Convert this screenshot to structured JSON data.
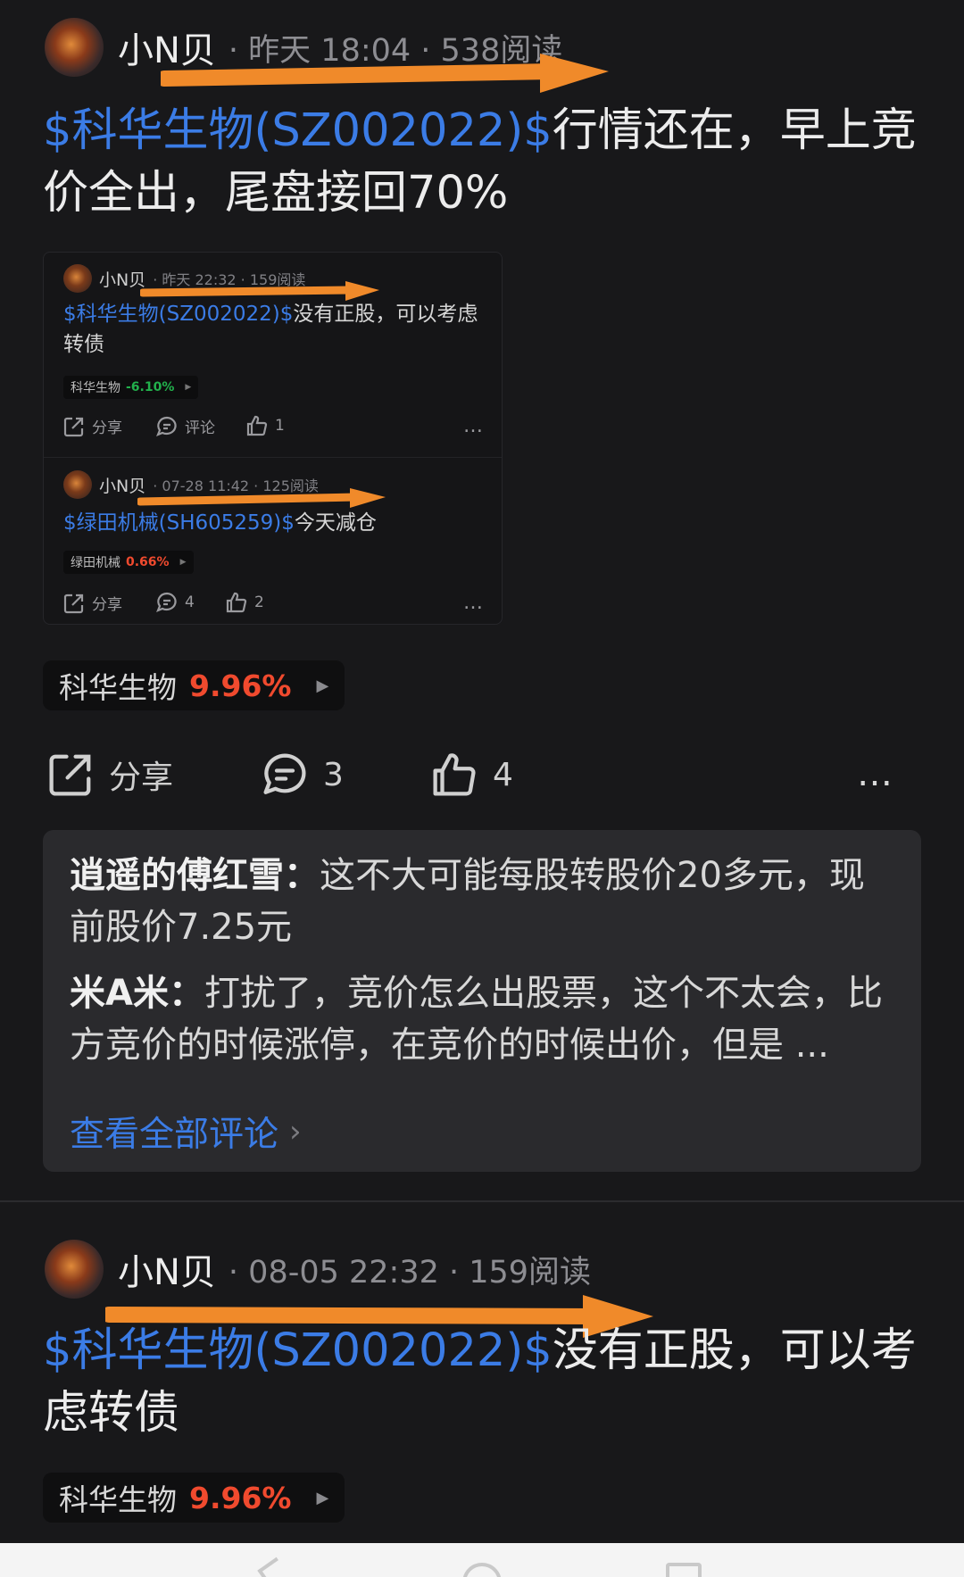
{
  "posts": [
    {
      "username": "小N贝",
      "meta": "· 昨天 18:04 · 538阅读",
      "cashtag": "$科华生物(SZ002022)$",
      "text": "行情还在，早上竞价全出，尾盘接回70%",
      "stock": {
        "name": "科华生物",
        "change": "9.96%"
      },
      "embedded": [
        {
          "username": "小N贝",
          "meta": "· 昨天 22:32 · 159阅读",
          "cashtag": "$科华生物(SZ002022)$",
          "text": "没有正股，可以考虑转债",
          "stock": {
            "name": "科华生物",
            "change": "-6.10%",
            "color": "#22b14c"
          },
          "share": "分享",
          "comment": "评论",
          "likes": "1"
        },
        {
          "username": "小N贝",
          "meta": "· 07-28 11:42 · 125阅读",
          "cashtag": "$绿田机械(SH605259)$",
          "text": "今天减仓",
          "stock": {
            "name": "绿田机械",
            "change": "0.66%",
            "color": "#f04a2e"
          },
          "share": "分享",
          "comment": "4",
          "likes": "2"
        }
      ],
      "actions": {
        "share": "分享",
        "comments": "3",
        "likes": "4"
      },
      "comments": [
        {
          "author": "逍遥的傅红雪：",
          "text": "这不大可能每股转股价20多元，现前股价7.25元"
        },
        {
          "author": "米A米：",
          "text": "打扰了，竞价怎么出股票，这个不太会，比方竞价的时候涨停，在竞价的时候出价，但是 ..."
        }
      ],
      "view_all": "查看全部评论"
    },
    {
      "username": "小N贝",
      "meta": "· 08-05 22:32 · 159阅读",
      "cashtag": "$科华生物(SZ002022)$",
      "text": "没有正股，可以考虑转债",
      "stock": {
        "name": "科华生物",
        "change": "9.96%"
      }
    }
  ],
  "colors": {
    "accent": "#3b7ce6",
    "up": "#f04a2e",
    "down": "#22b14c",
    "arrow": "#f08a2a"
  },
  "more_icon": "…"
}
